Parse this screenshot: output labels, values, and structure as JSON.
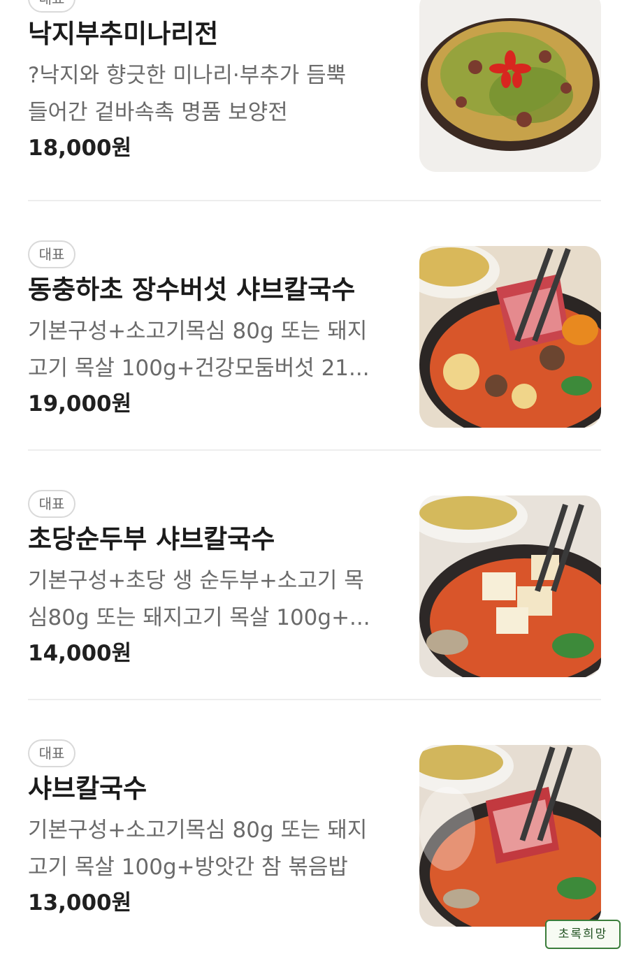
{
  "menu": {
    "items": [
      {
        "badge": "대표",
        "name": "낙지부추미나리전",
        "desc_line1": "?낙지와 향긋한 미나리·부추가 듬뿍",
        "desc_line2": "들어간 겉바속촉 명품 보양전",
        "price": "18,000원",
        "image_icon": "seafood-pancake-image"
      },
      {
        "badge": "대표",
        "name": "동충하초 장수버섯 샤브칼국수",
        "desc_line1": "기본구성+소고기목심 80g 또는 돼지",
        "desc_line2": "고기 목살 100g+건강모둠버섯 21...",
        "price": "19,000원",
        "image_icon": "mushroom-shabu-image"
      },
      {
        "badge": "대표",
        "name": "초당순두부 샤브칼국수",
        "desc_line1": "기본구성+초당 생 순두부+소고기 목",
        "desc_line2": "심80g 또는 돼지고기 목살 100g+...",
        "price": "14,000원",
        "image_icon": "tofu-shabu-image"
      },
      {
        "badge": "대표",
        "name": "샤브칼국수",
        "desc_line1": "기본구성+소고기목심 80g 또는 돼지",
        "desc_line2": "고기 목살 100g+방앗간 참 볶음밥",
        "price": "13,000원",
        "image_icon": "shabu-kalguksu-image"
      }
    ]
  },
  "watermark": {
    "text": "초록희망"
  },
  "colors": {
    "badge_border": "#d9d9d9",
    "divider": "#ededed",
    "desc_text": "#6a6a6a",
    "title_text": "#1b1b1b"
  }
}
